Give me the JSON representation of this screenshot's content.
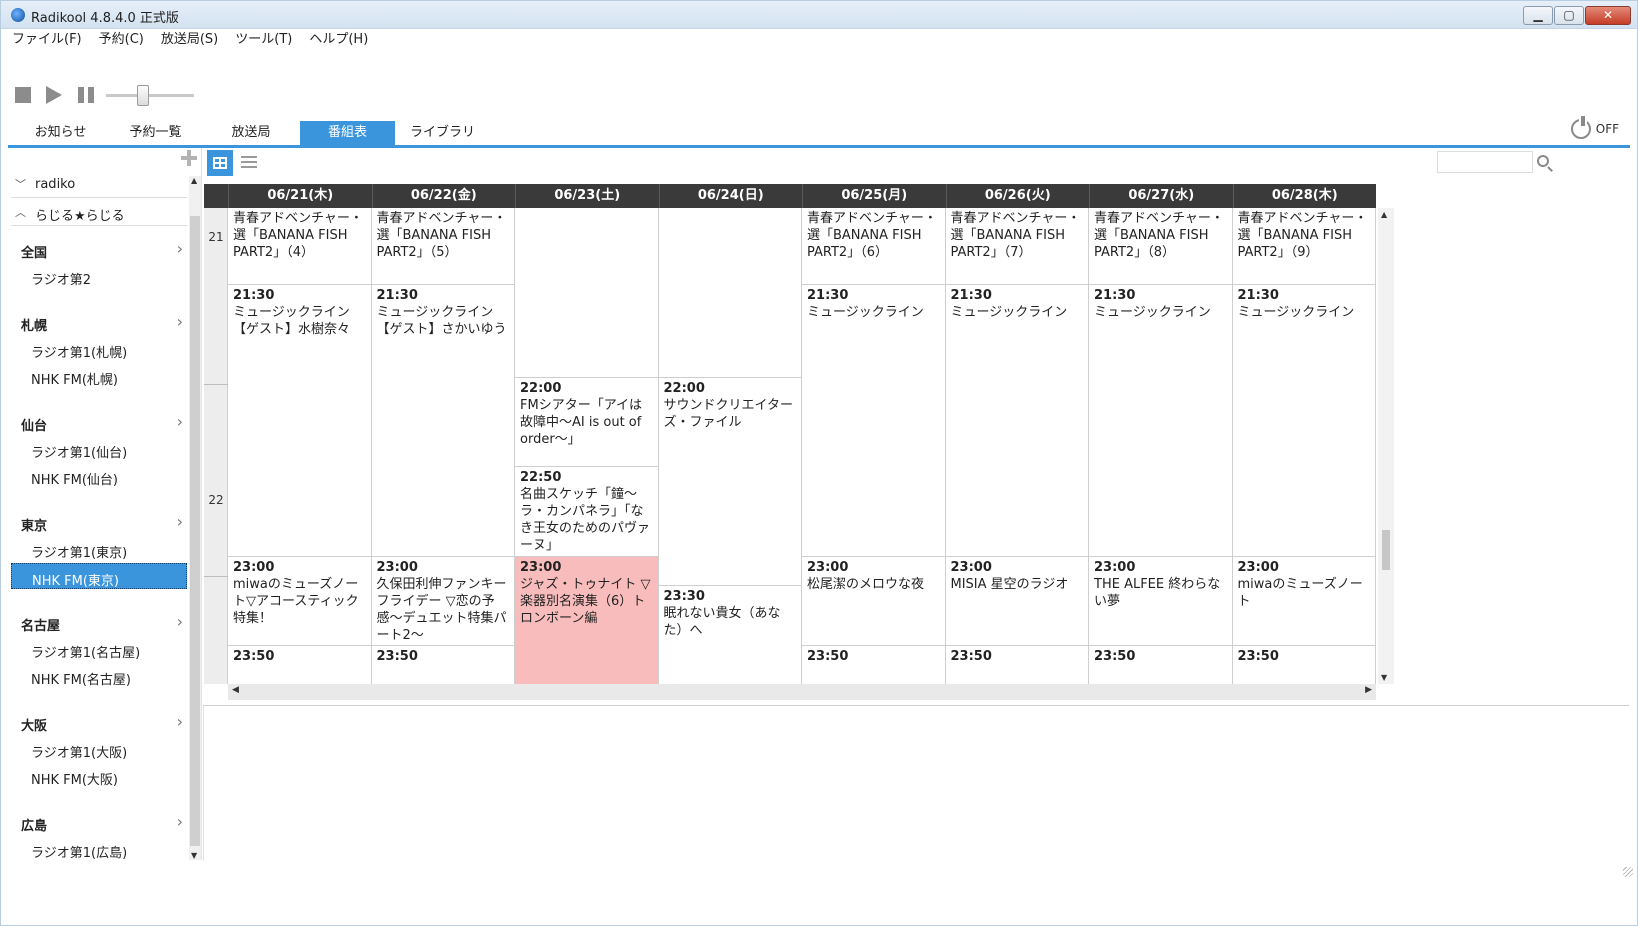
{
  "window": {
    "title": "Radikool 4.8.4.0 正式版",
    "controls": {
      "minimize": "▁",
      "maximize": "▢",
      "close": "✕"
    }
  },
  "menu": [
    "ファイル(F)",
    "予約(C)",
    "放送局(S)",
    "ツール(T)",
    "ヘルプ(H)"
  ],
  "tabs": [
    {
      "label": "お知らせ",
      "active": false
    },
    {
      "label": "予約一覧",
      "active": false
    },
    {
      "label": "放送局",
      "active": false
    },
    {
      "label": "番組表",
      "active": true
    },
    {
      "label": "ライブラリ",
      "active": false
    }
  ],
  "power": {
    "label": "OFF"
  },
  "volume": {
    "level": 0.42
  },
  "search": {
    "placeholder": ""
  },
  "sidebar": {
    "groups": [
      {
        "label": "radiko",
        "expanded": false
      },
      {
        "label": "らじる★らじる",
        "expanded": true
      }
    ],
    "regions": [
      {
        "name": "全国",
        "stations": [
          "ラジオ第2"
        ]
      },
      {
        "name": "札幌",
        "stations": [
          "ラジオ第1(札幌)",
          "NHK FM(札幌)"
        ]
      },
      {
        "name": "仙台",
        "stations": [
          "ラジオ第1(仙台)",
          "NHK FM(仙台)"
        ]
      },
      {
        "name": "東京",
        "stations": [
          "ラジオ第1(東京)",
          "NHK FM(東京)"
        ]
      },
      {
        "name": "名古屋",
        "stations": [
          "ラジオ第1(名古屋)",
          "NHK FM(名古屋)"
        ]
      },
      {
        "name": "大阪",
        "stations": [
          "ラジオ第1(大阪)",
          "NHK FM(大阪)"
        ]
      },
      {
        "name": "広島",
        "stations": [
          "ラジオ第1(広島)"
        ]
      }
    ],
    "selected_station": "NHK FM(東京)"
  },
  "schedule": {
    "days": [
      "06/21(木)",
      "06/22(金)",
      "06/23(土)",
      "06/24(日)",
      "06/25(月)",
      "06/26(火)",
      "06/27(水)",
      "06/28(木)"
    ],
    "hours": [
      "21",
      "22"
    ],
    "programs": [
      {
        "day": 0,
        "start": "",
        "title": "青春アドベンチャー・選「BANANA FISH PART2」（4）",
        "s": 0,
        "e": 4.8
      },
      {
        "day": 1,
        "start": "",
        "title": "青春アドベンチャー・選「BANANA FISH PART2」（5）",
        "s": 0,
        "e": 4.8
      },
      {
        "day": 4,
        "start": "",
        "title": "青春アドベンチャー・選「BANANA FISH PART2」（6）",
        "s": 0,
        "e": 4.8
      },
      {
        "day": 5,
        "start": "",
        "title": "青春アドベンチャー・選「BANANA FISH PART2」（7）",
        "s": 0,
        "e": 4.8
      },
      {
        "day": 6,
        "start": "",
        "title": "青春アドベンチャー・選「BANANA FISH PART2」（8）",
        "s": 0,
        "e": 4.8
      },
      {
        "day": 7,
        "start": "",
        "title": "青春アドベンチャー・選「BANANA FISH PART2」（9）",
        "s": 0,
        "e": 4.8
      },
      {
        "day": 2,
        "start": "",
        "title": "",
        "s": 0,
        "e": 10.6
      },
      {
        "day": 3,
        "start": "",
        "title": "",
        "s": 0,
        "e": 10.6
      },
      {
        "day": 0,
        "start": "21:30",
        "title": "ミュージックライン【ゲスト】水樹奈々",
        "s": 4.8,
        "e": 21.8
      },
      {
        "day": 1,
        "start": "21:30",
        "title": "ミュージックライン【ゲスト】さかいゆう",
        "s": 4.8,
        "e": 21.8
      },
      {
        "day": 4,
        "start": "21:30",
        "title": "ミュージックライン",
        "s": 4.8,
        "e": 21.8
      },
      {
        "day": 5,
        "start": "21:30",
        "title": "ミュージックライン",
        "s": 4.8,
        "e": 21.8
      },
      {
        "day": 6,
        "start": "21:30",
        "title": "ミュージックライン",
        "s": 4.8,
        "e": 21.8
      },
      {
        "day": 7,
        "start": "21:30",
        "title": "ミュージックライン",
        "s": 4.8,
        "e": 21.8
      },
      {
        "day": 2,
        "start": "22:00",
        "title": "FMシアター「アイは故障中〜AI is out of order〜」",
        "s": 10.6,
        "e": 16.2
      },
      {
        "day": 2,
        "start": "22:50",
        "title": "名曲スケッチ「鐘〜ラ・カンパネラ」「なき王女のためのパヴァーヌ」",
        "s": 16.2,
        "e": 21.8
      },
      {
        "day": 3,
        "start": "22:00",
        "title": "サウンドクリエイターズ・ファイル",
        "s": 10.6,
        "e": 23.6
      },
      {
        "day": 0,
        "start": "23:00",
        "title": "miwaのミューズノート▽アコースティック特集！",
        "s": 21.8,
        "e": 27.4,
        "highlight": false
      },
      {
        "day": 1,
        "start": "23:00",
        "title": "久保田利伸ファンキーフライデー ▽恋の予感〜デュエット特集パート2〜",
        "s": 21.8,
        "e": 27.4,
        "highlight": false
      },
      {
        "day": 2,
        "start": "23:00",
        "title": "ジャズ・トゥナイト ▽楽器別名演集（6）トロンボーン編",
        "s": 21.8,
        "e": 30,
        "highlight": true
      },
      {
        "day": 3,
        "start": "23:30",
        "title": "眠れない貴女（あなた）へ",
        "s": 23.6,
        "e": 30
      },
      {
        "day": 4,
        "start": "23:00",
        "title": "松尾潔のメロウな夜",
        "s": 21.8,
        "e": 27.4
      },
      {
        "day": 5,
        "start": "23:00",
        "title": "MISIA 星空のラジオ",
        "s": 21.8,
        "e": 27.4
      },
      {
        "day": 6,
        "start": "23:00",
        "title": "THE ALFEE 終わらない夢",
        "s": 21.8,
        "e": 27.4
      },
      {
        "day": 7,
        "start": "23:00",
        "title": "miwaのミューズノート",
        "s": 21.8,
        "e": 27.4
      },
      {
        "day": 0,
        "start": "23:50",
        "title": "",
        "s": 27.4,
        "e": 32
      },
      {
        "day": 1,
        "start": "23:50",
        "title": "",
        "s": 27.4,
        "e": 32
      },
      {
        "day": 4,
        "start": "23:50",
        "title": "",
        "s": 27.4,
        "e": 32
      },
      {
        "day": 5,
        "start": "23:50",
        "title": "",
        "s": 27.4,
        "e": 32
      },
      {
        "day": 6,
        "start": "23:50",
        "title": "",
        "s": 27.4,
        "e": 32
      },
      {
        "day": 7,
        "start": "23:50",
        "title": "",
        "s": 27.4,
        "e": 32
      }
    ]
  }
}
